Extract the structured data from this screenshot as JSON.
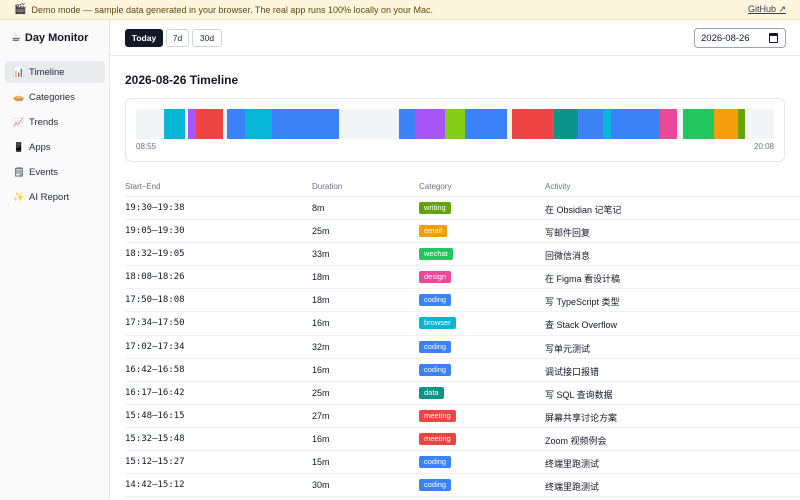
{
  "banner": {
    "text": "Demo mode — sample data generated in your browser. The real app runs 100% locally on your Mac.",
    "link": "GitHub ↗"
  },
  "sidebar": {
    "brand": "Day Monitor",
    "items": [
      {
        "label": "Timeline",
        "icon": "📊",
        "active": true
      },
      {
        "label": "Categories",
        "icon": "🥧",
        "active": false
      },
      {
        "label": "Trends",
        "icon": "📈",
        "active": false
      },
      {
        "label": "Apps",
        "icon": "📱",
        "active": false
      },
      {
        "label": "Events",
        "icon": "🗒",
        "active": false
      },
      {
        "label": "AI Report",
        "icon": "✨",
        "active": false
      }
    ]
  },
  "toolbar": {
    "ranges": [
      "Today",
      "7d",
      "30d"
    ],
    "selected_range": "Today",
    "date_value": "2026-08-26"
  },
  "page": {
    "title": "2026-08-26 Timeline"
  },
  "timeline": {
    "start_label": "08:55",
    "end_label": "20:08"
  },
  "table": {
    "headers": [
      "Start–End",
      "Duration",
      "Category",
      "Activity"
    ],
    "rows": [
      {
        "time": "19:30–19:38",
        "duration": "8m",
        "category": "writing",
        "activity": "在 Obsidian 记笔记"
      },
      {
        "time": "19:05–19:30",
        "duration": "25m",
        "category": "email",
        "activity": "写邮件回复"
      },
      {
        "time": "18:32–19:05",
        "duration": "33m",
        "category": "wechat",
        "activity": "回微信消息"
      },
      {
        "time": "18:08–18:26",
        "duration": "18m",
        "category": "design",
        "activity": "在 Figma 看设计稿"
      },
      {
        "time": "17:50–18:08",
        "duration": "18m",
        "category": "coding",
        "activity": "写 TypeScript 类型"
      },
      {
        "time": "17:34–17:50",
        "duration": "16m",
        "category": "browser",
        "activity": "查 Stack Overflow"
      },
      {
        "time": "17:02–17:34",
        "duration": "32m",
        "category": "coding",
        "activity": "写单元测试"
      },
      {
        "time": "16:42–16:58",
        "duration": "16m",
        "category": "coding",
        "activity": "调试接口报错"
      },
      {
        "time": "16:17–16:42",
        "duration": "25m",
        "category": "data",
        "activity": "写 SQL 查询数据"
      },
      {
        "time": "15:48–16:15",
        "duration": "27m",
        "category": "meeting",
        "activity": "屏幕共享讨论方案"
      },
      {
        "time": "15:32–15:48",
        "duration": "16m",
        "category": "meeting",
        "activity": "Zoom 视频例会"
      },
      {
        "time": "15:12–15:27",
        "duration": "15m",
        "category": "coding",
        "activity": "终端里跑测试"
      },
      {
        "time": "14:42–15:12",
        "duration": "30m",
        "category": "coding",
        "activity": "终端里跑测试"
      }
    ]
  },
  "category_colors": {
    "writing": "#65a30d",
    "email": "#f59e0b",
    "wechat": "#22c55e",
    "design": "#ec4899",
    "coding": "#3b82f6",
    "browser": "#06b6d4",
    "data": "#0d9488",
    "meeting": "#ef4444",
    "research": "#a855f7",
    "other": "#84cc16",
    "learning": "#0ea5e9"
  }
}
